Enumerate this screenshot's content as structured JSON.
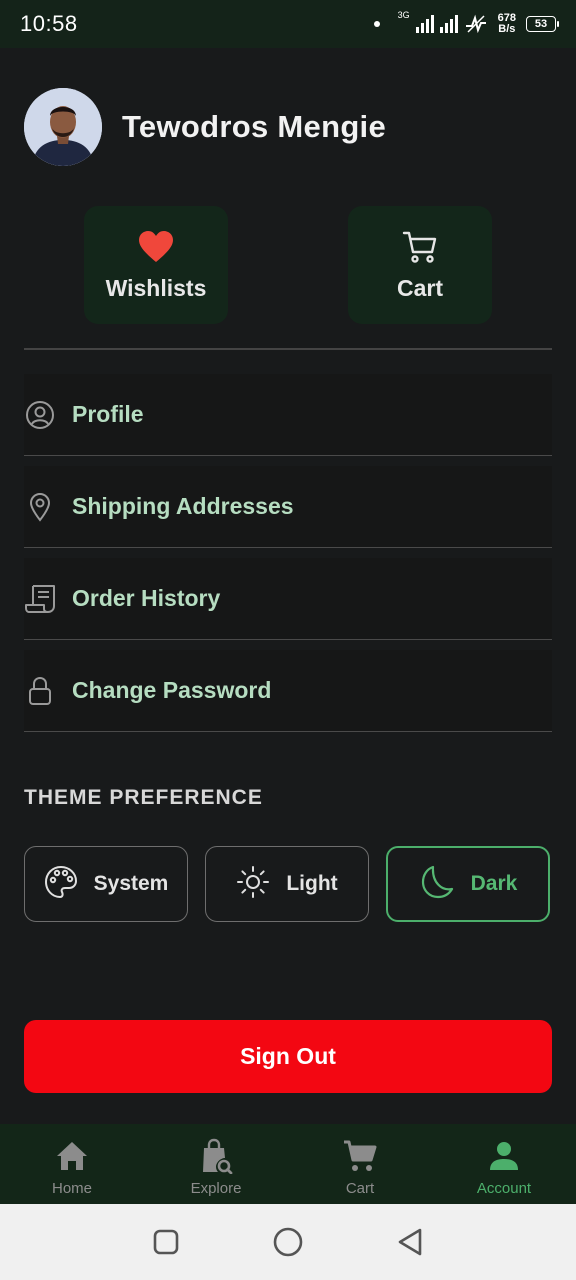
{
  "status_bar": {
    "time": "10:58",
    "network": "3G",
    "speed_value": "678",
    "speed_unit": "B/s",
    "battery": "53"
  },
  "user": {
    "name": "Tewodros  Mengie"
  },
  "quick_actions": [
    {
      "label": "Wishlists",
      "icon": "heart-icon"
    },
    {
      "label": "Cart",
      "icon": "cart-icon"
    }
  ],
  "menu": [
    {
      "label": "Profile",
      "icon": "user-circle-icon"
    },
    {
      "label": "Shipping Addresses",
      "icon": "location-pin-icon"
    },
    {
      "label": "Order History",
      "icon": "receipt-icon"
    },
    {
      "label": "Change Password",
      "icon": "lock-icon"
    }
  ],
  "theme": {
    "title": "THEME PREFERENCE",
    "options": [
      {
        "label": "System",
        "icon": "palette-icon"
      },
      {
        "label": "Light",
        "icon": "sun-icon"
      },
      {
        "label": "Dark",
        "icon": "moon-icon"
      }
    ],
    "selected": "Dark"
  },
  "sign_out": {
    "label": "Sign Out"
  },
  "bottom_nav": {
    "items": [
      {
        "label": "Home",
        "icon": "home-icon"
      },
      {
        "label": "Explore",
        "icon": "explore-bag-icon"
      },
      {
        "label": "Cart",
        "icon": "cart-icon"
      },
      {
        "label": "Account",
        "icon": "account-icon"
      }
    ],
    "active": "Account"
  },
  "colors": {
    "background": "#181a1b",
    "accent_green": "#4caf6b",
    "menu_text": "#b6ddc1",
    "danger": "#f30712",
    "heart": "#f0473b"
  }
}
